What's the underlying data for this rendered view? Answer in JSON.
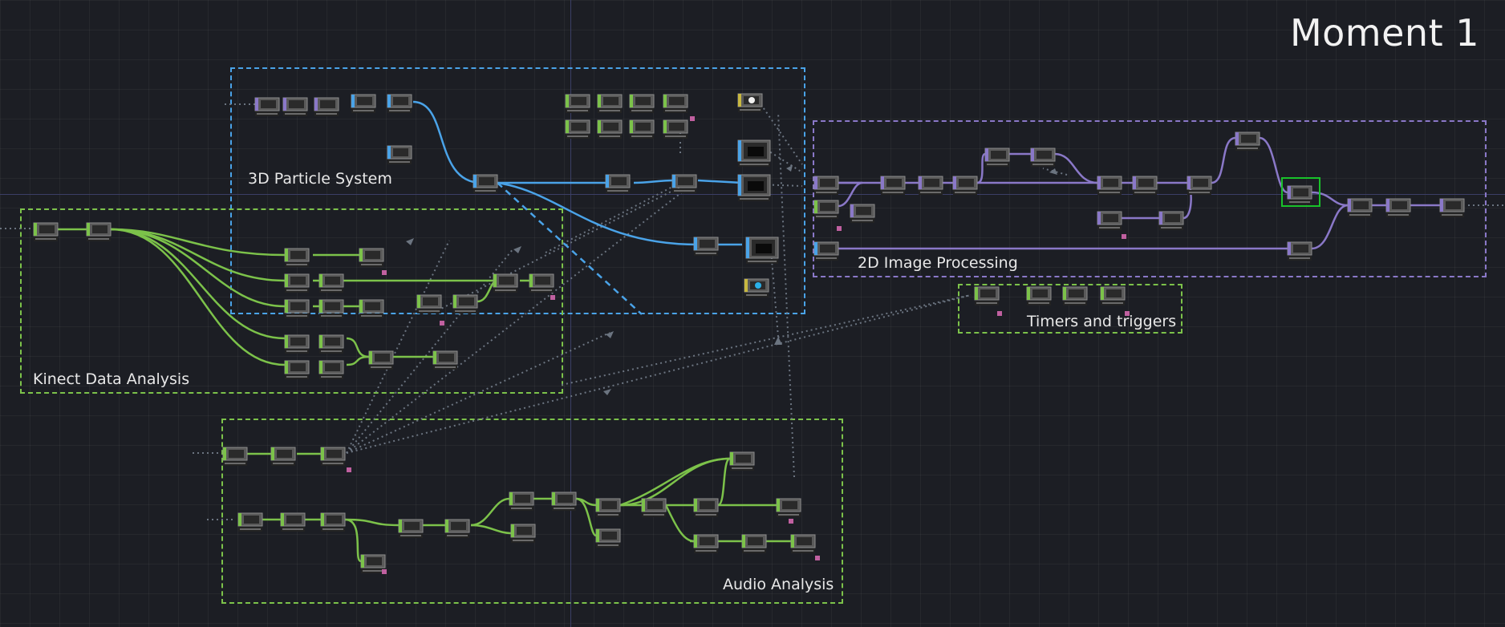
{
  "network": {
    "title": "Moment 1",
    "groups": [
      {
        "label": "3D Particle System",
        "color": "#4aa3e8"
      },
      {
        "label": "Kinect Data Analysis",
        "color": "#7cc24a"
      },
      {
        "label": "2D Image Processing",
        "color": "#8a78c8"
      },
      {
        "label": "Timers and triggers",
        "color": "#7cc24a"
      },
      {
        "label": "Audio Analysis",
        "color": "#7cc24a"
      }
    ],
    "colors": {
      "canvas": "#1c1e24",
      "top_wire": "#4aa3e8",
      "chop_wire": "#7cc24a",
      "comp_wire": "#8a78c8",
      "export_wire": "#6b7480",
      "selected": "#19c22a"
    },
    "icons": [
      "light-bulb-icon",
      "camera-icon",
      "sliders-icon"
    ]
  }
}
